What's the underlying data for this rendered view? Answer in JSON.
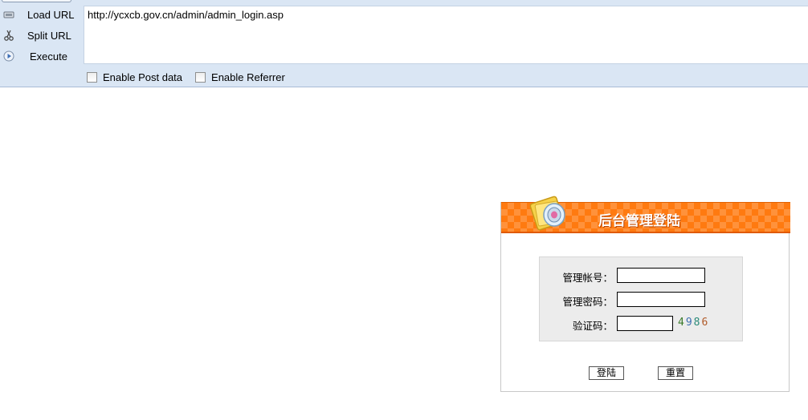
{
  "hackbar": {
    "load_url_label": "Load URL",
    "split_url_label": "Split URL",
    "execute_label": "Execute",
    "url_value": "http://ycxcb.gov.cn/admin/admin_login.asp",
    "enable_post_label": "Enable Post data",
    "enable_referrer_label": "Enable Referrer",
    "icons": [
      "load-url-icon",
      "split-url-icon",
      "execute-icon"
    ]
  },
  "login": {
    "title": "后台管理登陆",
    "username_label": "管理帐号：",
    "password_label": "管理密码：",
    "captcha_label": "验证码：",
    "username_value": "",
    "password_value": "",
    "captcha_value": "",
    "captcha_digits": [
      {
        "char": "4",
        "color": "#3a7a2a"
      },
      {
        "char": "9",
        "color": "#3c6fb0"
      },
      {
        "char": "8",
        "color": "#2a8a78"
      },
      {
        "char": "6",
        "color": "#b05a28"
      }
    ],
    "login_button": "登陆",
    "reset_button": "重置",
    "header_color": "#ff7a10"
  }
}
